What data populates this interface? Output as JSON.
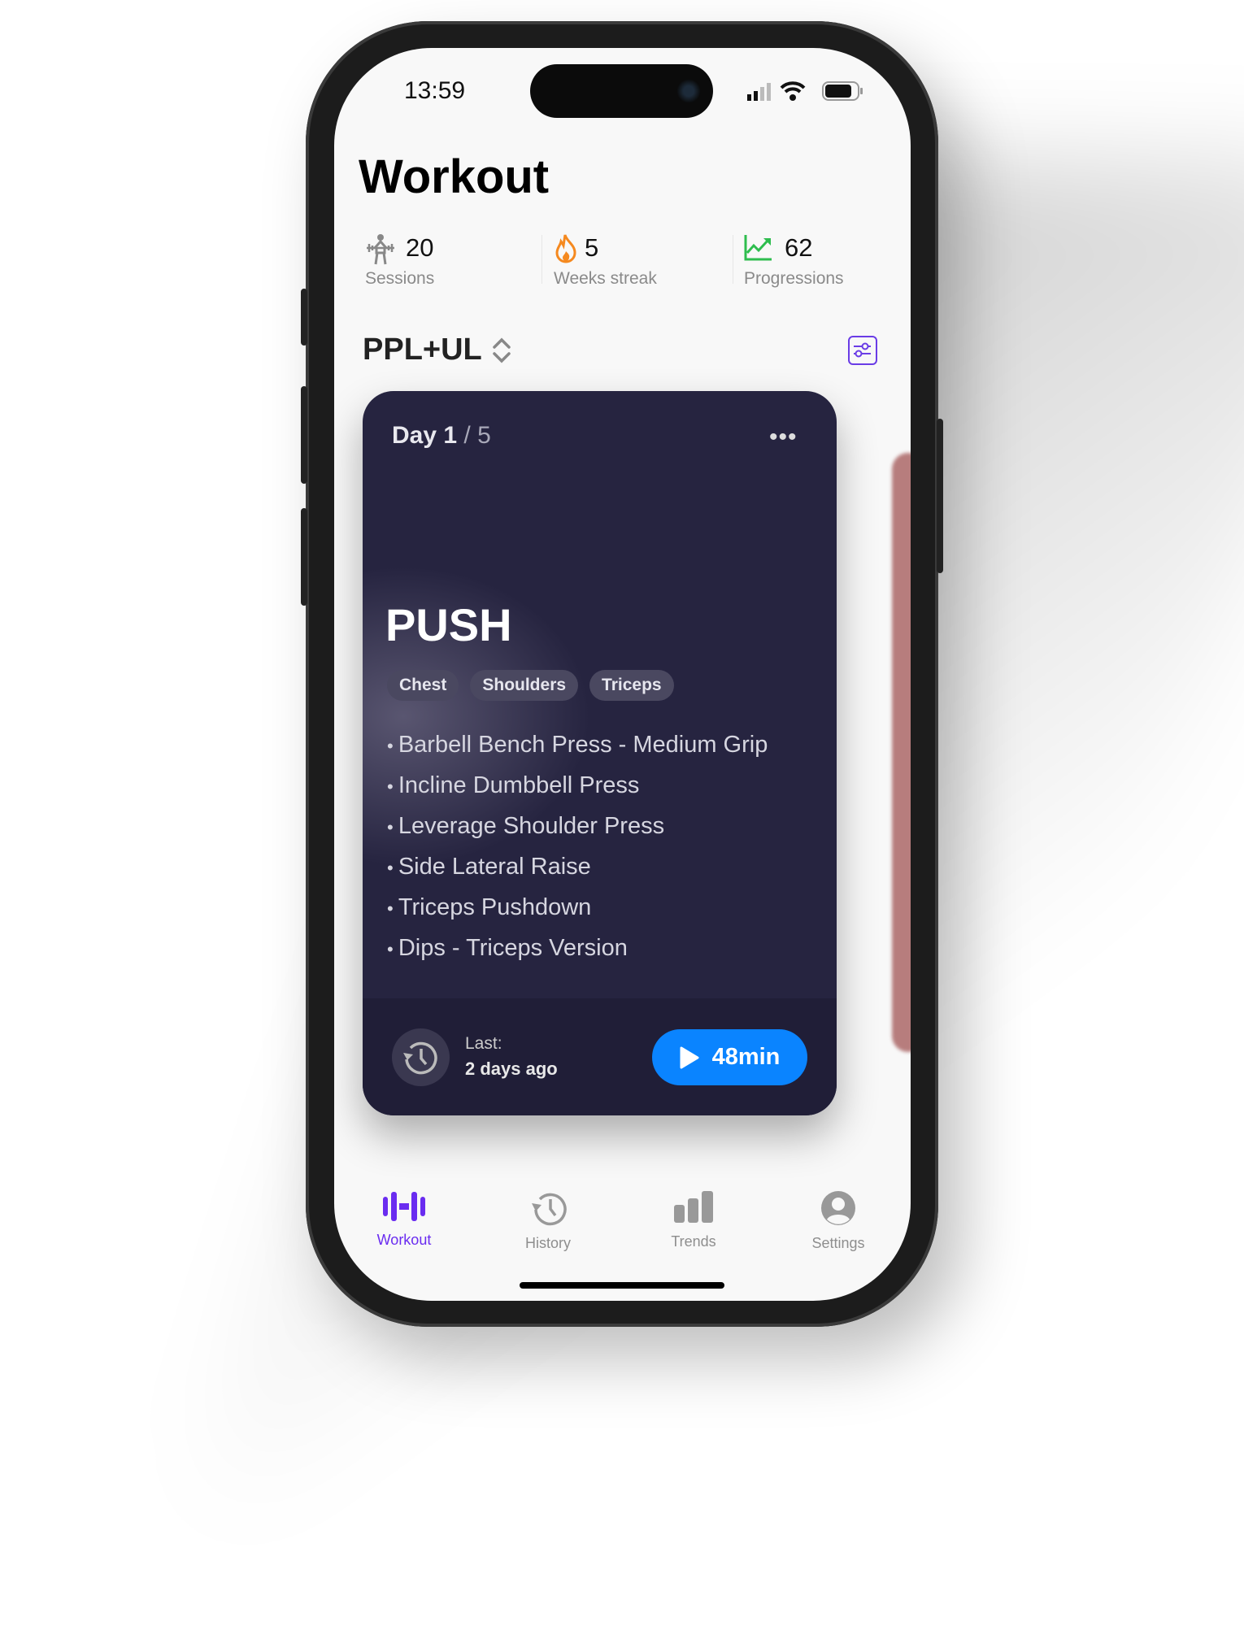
{
  "status_bar": {
    "time": "13:59"
  },
  "header": {
    "title": "Workout"
  },
  "stats": [
    {
      "icon": "weightlifter-icon",
      "value": "20",
      "label": "Sessions"
    },
    {
      "icon": "flame-icon",
      "value": "5",
      "label": "Weeks streak"
    },
    {
      "icon": "trend-up-icon",
      "value": "62",
      "label": "Progressions"
    }
  ],
  "program": {
    "name": "PPL+UL"
  },
  "card": {
    "day_label": "Day 1",
    "day_total": "/ 5",
    "title": "PUSH",
    "tags": [
      "Chest",
      "Shoulders",
      "Triceps"
    ],
    "exercises": [
      "Barbell Bench Press - Medium Grip",
      "Incline Dumbbell Press",
      "Leverage Shoulder Press",
      "Side Lateral Raise",
      "Triceps Pushdown",
      "Dips - Triceps Version"
    ],
    "last_label": "Last:",
    "last_value": "2 days ago",
    "start_label": "48min"
  },
  "tabs": [
    {
      "label": "Workout",
      "active": true
    },
    {
      "label": "History"
    },
    {
      "label": "Trends"
    },
    {
      "label": "Settings"
    }
  ],
  "colors": {
    "accent": "#6a2cf0",
    "start_button": "#0a84ff",
    "card": "#262440",
    "streak": "#f5891f",
    "progress": "#2ebd4e",
    "next_card": "#b77d7d"
  }
}
